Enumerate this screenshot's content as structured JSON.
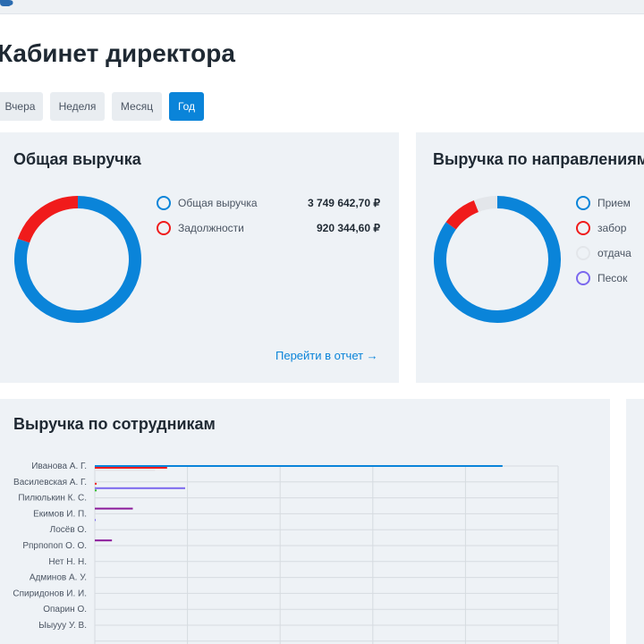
{
  "page": {
    "title": "Кабинет директора"
  },
  "periods": [
    {
      "label": "Вчера",
      "active": false
    },
    {
      "label": "Неделя",
      "active": false
    },
    {
      "label": "Месяц",
      "active": false
    },
    {
      "label": "Год",
      "active": true
    }
  ],
  "revenue_card": {
    "title": "Общая выручка",
    "legend": [
      {
        "label": "Общая выручка",
        "value": "3 749 642,70 ₽",
        "color": "#0a84d9"
      },
      {
        "label": "Задолжности",
        "value": "920 344,60 ₽",
        "color": "#f01b1b"
      }
    ],
    "link_label": "Перейти в отчет →"
  },
  "directions_card": {
    "title": "Выручка по направлениям",
    "legend": [
      {
        "label": "Прием",
        "color": "#0a84d9"
      },
      {
        "label": "забор",
        "color": "#f01b1b"
      },
      {
        "label": "отдача",
        "color": "#e3e6ea"
      },
      {
        "label": "Песок",
        "color": "#7b68ee"
      }
    ]
  },
  "employees_card": {
    "title": "Выручка по сотрудникам"
  },
  "chart_data": [
    {
      "type": "pie",
      "title": "Общая выручка",
      "labels": [
        "Общая выручка",
        "Задолжности"
      ],
      "values": [
        3749642.7,
        920344.6
      ],
      "colors": [
        "#0a84d9",
        "#f01b1b"
      ]
    },
    {
      "type": "pie",
      "title": "Выручка по направлениям",
      "labels": [
        "Прием",
        "забор",
        "отдача",
        "Песок"
      ],
      "values": [
        85,
        9,
        6,
        0
      ],
      "colors": [
        "#0a84d9",
        "#f01b1b",
        "#e3e6ea",
        "#7b68ee"
      ]
    },
    {
      "type": "bar",
      "orientation": "horizontal",
      "title": "Выручка по сотрудникам",
      "categories": [
        "Иванова А. Г.",
        "Василевская А. Г.",
        "Пилюлькин К. С.",
        "Екимов И. П.",
        "Лосёв О.",
        "Рпрпопоп О. О.",
        "Нет Н. Н.",
        "Админов А. У.",
        "Спиридонов И. И.",
        "Опарин О.",
        "Ыыууу У. В."
      ],
      "xlim": [
        0,
        100
      ],
      "grid": true,
      "series": [
        {
          "color": "#0a84d9",
          "values": [
            88,
            0,
            0,
            0,
            0,
            0,
            0,
            0,
            0,
            0,
            0
          ]
        },
        {
          "color": "#f01b1b",
          "values": [
            15.6,
            0.4,
            0,
            0,
            0,
            0,
            0,
            0,
            0,
            0,
            0
          ]
        },
        {
          "color": "#e3e6ea",
          "values": [
            13,
            0,
            0,
            0,
            0,
            0,
            0,
            0,
            0,
            0,
            0
          ]
        },
        {
          "color": "#7b68ee",
          "values": [
            0,
            19.5,
            0,
            0.2,
            0,
            0,
            0,
            0,
            0,
            0,
            0
          ]
        },
        {
          "color": "#2eb82e",
          "values": [
            0,
            0.4,
            0,
            0,
            0,
            0,
            0,
            0,
            0,
            0,
            0
          ]
        },
        {
          "color": "#8b1a9a",
          "values": [
            0,
            0,
            8.2,
            0,
            3.7,
            0,
            0,
            0,
            0,
            0,
            0
          ]
        }
      ]
    }
  ]
}
